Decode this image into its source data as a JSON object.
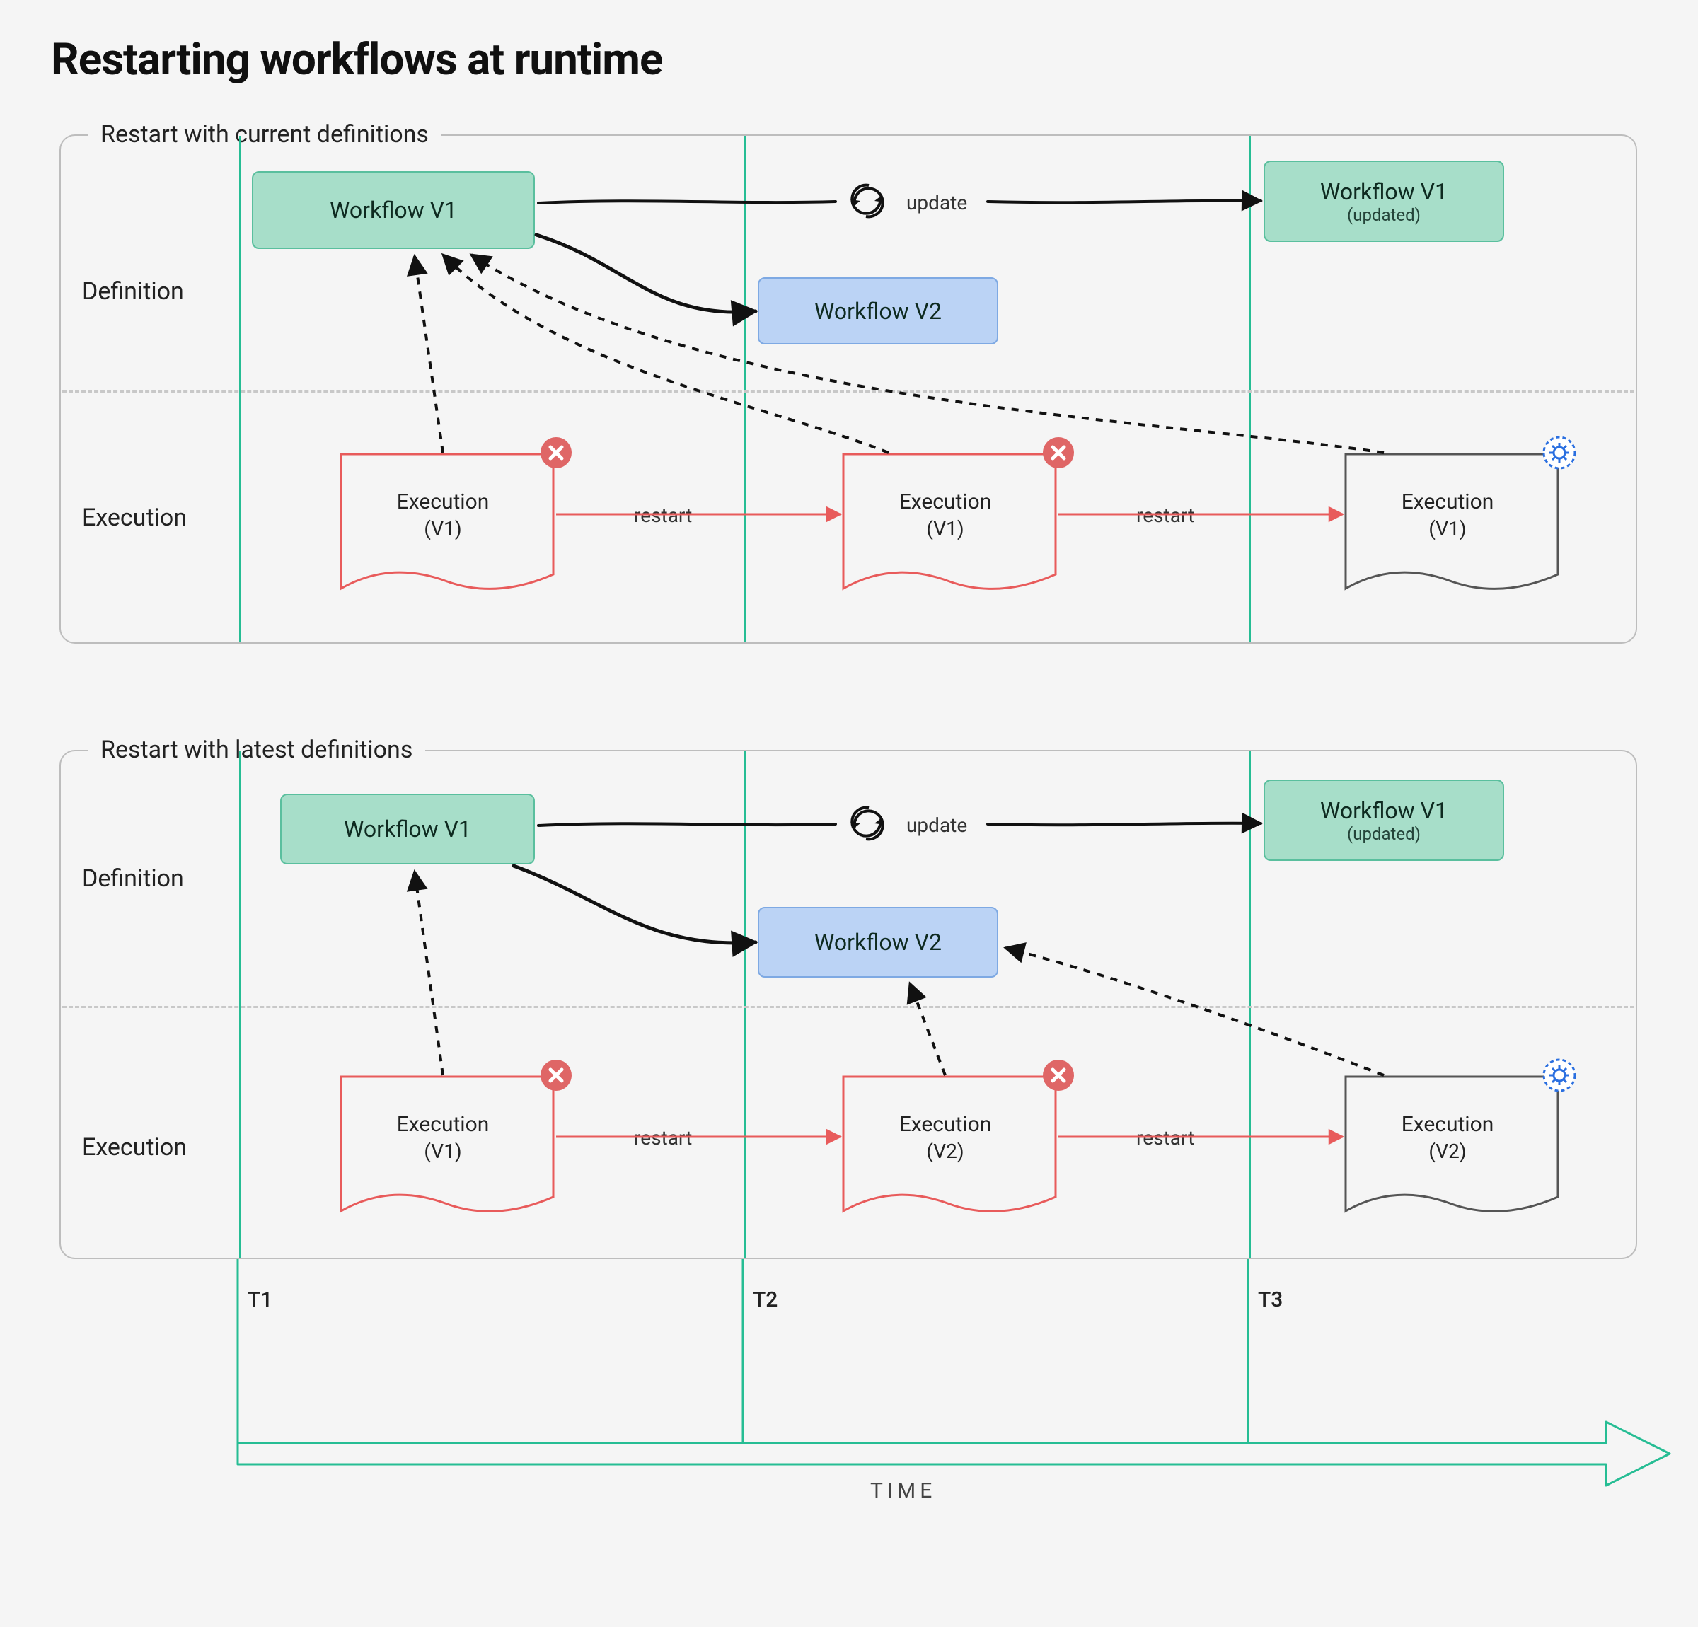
{
  "title": "Restarting workflows at runtime",
  "panelA": {
    "legend": "Restart with current definitions",
    "rowDef": "Definition",
    "rowExec": "Execution",
    "wfV1": "Workflow V1",
    "wfV2": "Workflow V2",
    "wfV1u": "Workflow V1",
    "wfV1u_sub": "(updated)",
    "update": "update",
    "restart1": "restart",
    "restart2": "restart",
    "exec1": "Execution",
    "exec1v": "(V1)",
    "exec2": "Execution",
    "exec2v": "(V1)",
    "exec3": "Execution",
    "exec3v": "(V1)"
  },
  "panelB": {
    "legend": "Restart with latest definitions",
    "rowDef": "Definition",
    "rowExec": "Execution",
    "wfV1": "Workflow V1",
    "wfV2": "Workflow V2",
    "wfV1u": "Workflow V1",
    "wfV1u_sub": "(updated)",
    "update": "update",
    "restart1": "restart",
    "restart2": "restart",
    "exec1": "Execution",
    "exec1v": "(V1)",
    "exec2": "Execution",
    "exec2v": "(V2)",
    "exec3": "Execution",
    "exec3v": "(V2)"
  },
  "timeline": {
    "t1": "T1",
    "t2": "T2",
    "t3": "T3",
    "axis": "TIME"
  },
  "colors": {
    "teal": "#26bd94",
    "red": "#e85b5b",
    "blue_icon": "#2a6fe0"
  }
}
